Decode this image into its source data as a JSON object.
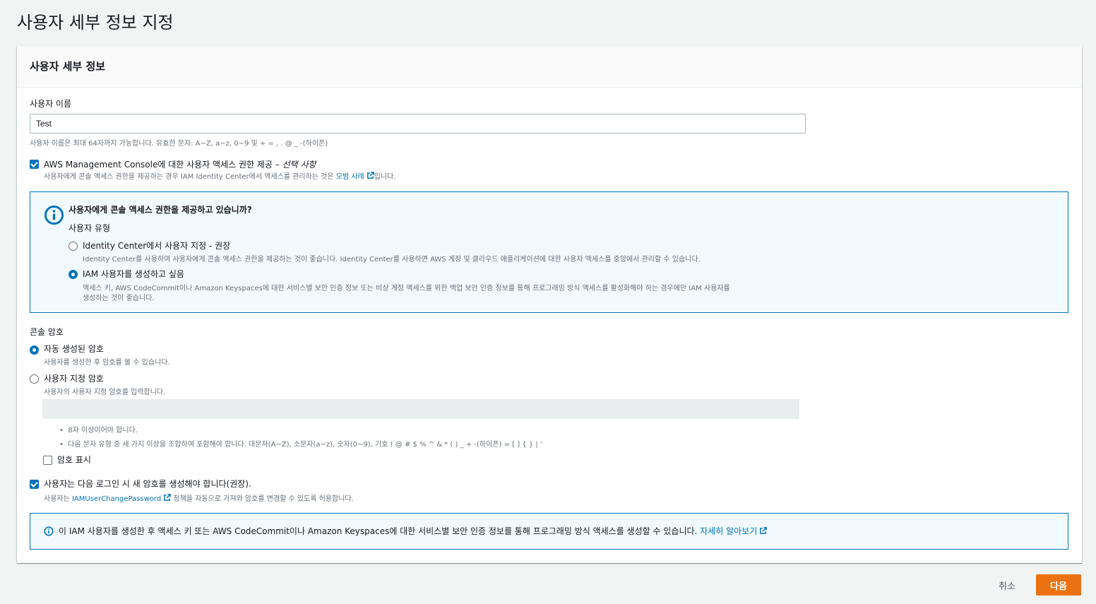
{
  "page": {
    "title": "사용자 세부 정보 지정"
  },
  "panel": {
    "title": "사용자 세부 정보"
  },
  "username": {
    "label": "사용자 이름",
    "value": "Test",
    "hint": "사용자 이름은 최대 64자까지 가능합니다. 유효한 문자: A~Z, a~z, 0~9 및 + = , . @ _ -(하이픈)"
  },
  "console_access": {
    "checked": true,
    "label_main": "AWS Management Console에 대한 사용자 액세스 권한 제공 – ",
    "label_optional": "선택 사항",
    "hint_prefix": "사용자에게 콘솔 액세스 권한을 제공하는 경우 IAM Identity Center에서 액세스를 관리하는 것은 ",
    "hint_link": "모범 사례",
    "hint_suffix": "입니다."
  },
  "info_box": {
    "title": "사용자에게 콘솔 액세스 권한을 제공하고 있습니까?",
    "user_type_label": "사용자 유형",
    "options": [
      {
        "label": "Identity Center에서 사용자 지정 - 권장",
        "description": "Identity Center를 사용하여 사용자에게 콘솔 액세스 권한을 제공하는 것이 좋습니다. Identity Center를 사용하면 AWS 계정 및 클라우드 애플리케이션에 대한 사용자 액세스를 중앙에서 관리할 수 있습니다.",
        "selected": false
      },
      {
        "label": "IAM 사용자를 생성하고 싶음",
        "description_line1": "액세스 키, AWS CodeCommit이나 Amazon Keyspaces에 대한 서비스별 보안 인증 정보 또는 비상 계정 액세스를 위한 백업 보안 인증 정보를 통해 프로그래밍 방식 액세스를 활성화해야 하는 경우에만 IAM 사용자를",
        "description_line2": "생성하는 것이 좋습니다.",
        "selected": true
      }
    ]
  },
  "password": {
    "label": "콘솔 암호",
    "options": [
      {
        "label": "자동 생성된 암호",
        "description": "사용자를 생성한 후 암호를 볼 수 있습니다.",
        "selected": true
      },
      {
        "label": "사용자 지정 암호",
        "description": "사용자의 사용자 지정 암호를 입력합니다.",
        "selected": false
      }
    ],
    "custom_value": "",
    "rules": [
      "8자 이상이어야 합니다.",
      "다음 문자 유형 중 세 가지 이상을 조합하여 포함해야 합니다. 대문자(A~Z), 소문자(a~z), 숫자(0~9), 기호 ! @ # $ % ^ & * ( ) _ + -(하이픈) = [ ] { } | '"
    ],
    "show_label": "암호 표시",
    "show_checked": false
  },
  "reset_password": {
    "checked": true,
    "label": "사용자는 다음 로그인 시 새 암호를 생성해야 합니다(권장).",
    "hint_prefix": "사용자는 ",
    "hint_link": "IAMUserChangePassword",
    "hint_suffix": " 정책을 자동으로 가져와 암호를 변경할 수 있도록 허용합니다."
  },
  "bottom_info": {
    "text": "이 IAM 사용자를 생성한 후 액세스 키 또는 AWS CodeCommit이나 Amazon Keyspaces에 대한 서비스별 보안 인증 정보를 통해 프로그래밍 방식 액세스를 생성할 수 있습니다. ",
    "link": "자세히 알아보기"
  },
  "footer": {
    "cancel_label": "취소",
    "next_label": "다음"
  },
  "colors": {
    "primary": "#ec7211",
    "link": "#0073bb",
    "info_bg": "#f1faff"
  }
}
